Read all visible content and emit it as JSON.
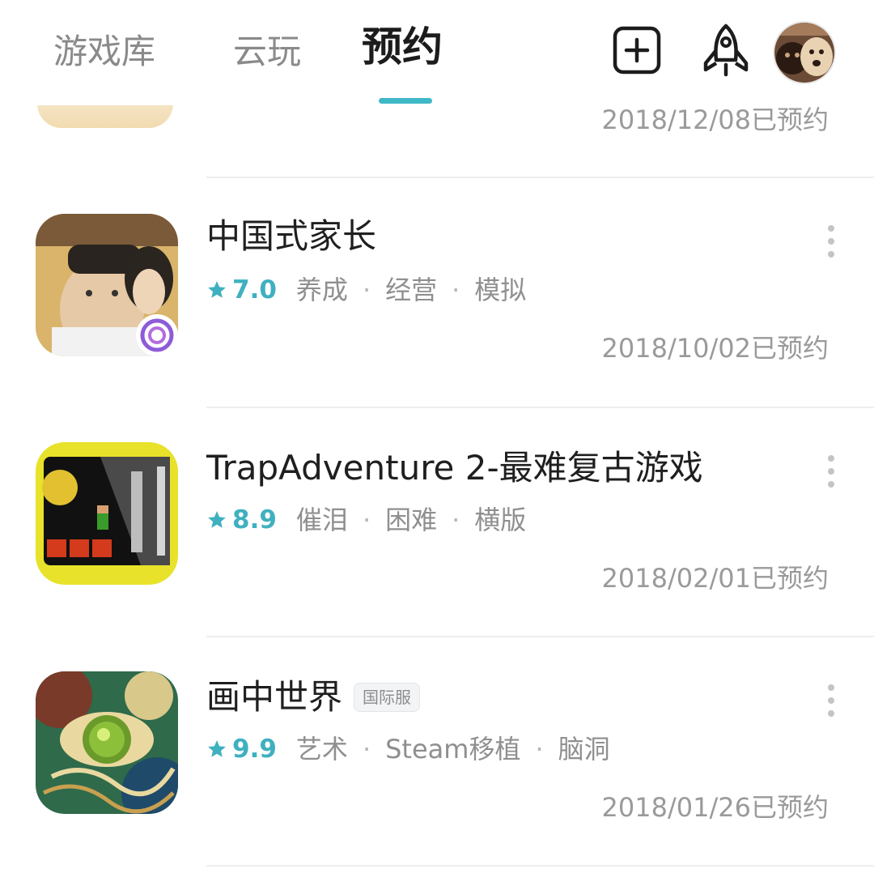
{
  "tabs": [
    {
      "label": "游戏库"
    },
    {
      "label": "云玩"
    },
    {
      "label": "预约"
    }
  ],
  "partial_row": {
    "date": "2018/12/08已预约"
  },
  "items": [
    {
      "title": "中国式家长",
      "rating": "7.0",
      "tags": [
        "养成",
        "经营",
        "模拟"
      ],
      "date": "2018/10/02已预约"
    },
    {
      "title": "TrapAdventure 2-最难复古游戏",
      "rating": "8.9",
      "tags": [
        "催泪",
        "困难",
        "横版"
      ],
      "date": "2018/02/01已预约"
    },
    {
      "title": "画中世界",
      "badge": "国际服",
      "rating": "9.9",
      "tags": [
        "艺术",
        "Steam移植",
        "脑洞"
      ],
      "date": "2018/01/26已预约"
    }
  ],
  "colors": {
    "accent": "#3fb8c6",
    "muted_text": "#8f8f8f"
  }
}
